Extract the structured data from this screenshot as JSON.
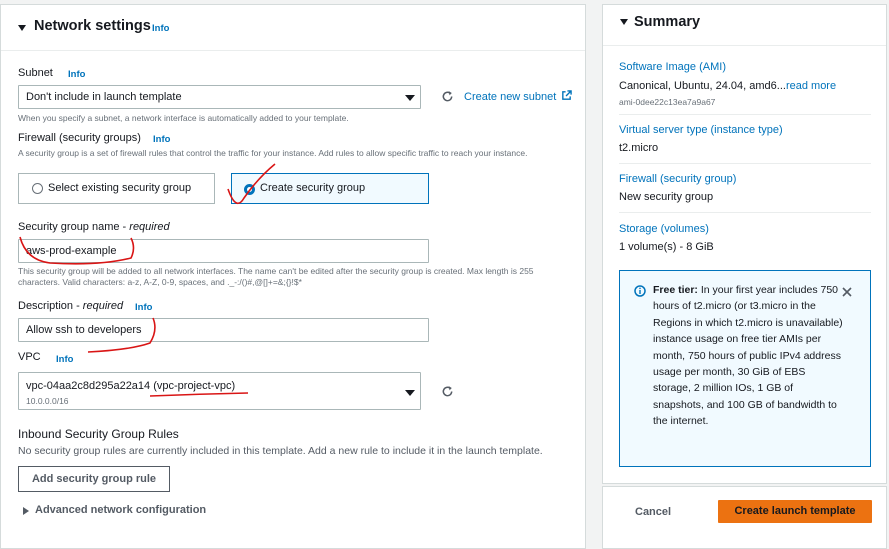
{
  "network": {
    "title": "Network settings",
    "title_info": "Info",
    "subnet": {
      "label": "Subnet",
      "info": "Info",
      "value": "Don't include in launch template",
      "create_link": "Create new subnet",
      "description": "When you specify a subnet, a network interface is automatically added to your template."
    },
    "firewall": {
      "label": "Firewall (security groups)",
      "info": "Info",
      "description": "A security group is a set of firewall rules that control the traffic for your instance. Add rules to allow specific traffic to reach your instance.",
      "options": [
        "Select existing security group",
        "Create security group"
      ],
      "selected": "Create security group"
    },
    "sg_name": {
      "label": "Security group name - ",
      "required": "required",
      "value": "aws-prod-example",
      "description": "This security group will be added to all network interfaces. The name can't be edited after the security group is created. Max length is 255 characters. Valid characters: a-z, A-Z, 0-9, spaces, and ._-:/()#,@[]+=&;{}!$*"
    },
    "description_field": {
      "label": "Description - ",
      "required": "required",
      "info": "Info",
      "value": "Allow ssh to developers"
    },
    "vpc": {
      "label": "VPC",
      "info": "Info",
      "value": "vpc-04aa2c8d295a22a14 (vpc-project-vpc)",
      "cidr": "10.0.0.0/16"
    },
    "inbound": {
      "title": "Inbound Security Group Rules",
      "description": "No security group rules are currently included in this template. Add a new rule to include it in the launch template.",
      "add_button": "Add security group rule"
    },
    "advanced": "Advanced network configuration"
  },
  "summary": {
    "title": "Summary",
    "ami_label": "Software Image (AMI)",
    "ami_value": "Canonical, Ubuntu, 24.04, amd6...",
    "ami_read_more": "read more",
    "ami_id": "ami-0dee22c13ea7a9a67",
    "instance_label": "Virtual server type (instance type)",
    "instance_value": "t2.micro",
    "firewall_label": "Firewall (security group)",
    "firewall_value": "New security group",
    "storage_label": "Storage (volumes)",
    "storage_value": "1 volume(s) - 8 GiB",
    "free_tier_title": "Free tier:",
    "free_tier_text": " In your first year includes 750 hours of t2.micro (or t3.micro in the Regions in which t2.micro is unavailable) instance usage on free tier AMIs per month, 750 hours of public IPv4 address usage per month, 30 GiB of EBS storage, 2 million IOs, 1 GB of snapshots, and 100 GB of bandwidth to the internet.",
    "cancel": "Cancel",
    "create": "Create launch template"
  },
  "colors": {
    "link": "#0073bb",
    "primary": "#ec7211",
    "annotation": "#d91515"
  }
}
